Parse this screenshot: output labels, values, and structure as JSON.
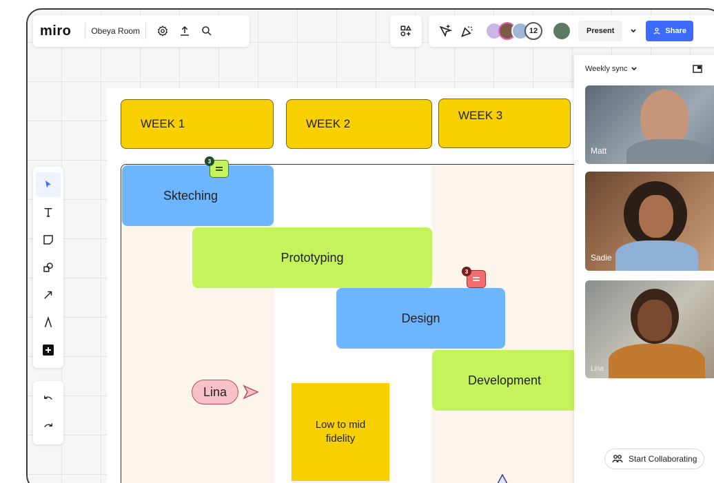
{
  "app": {
    "logo": "miro",
    "board_name": "Obeya Room"
  },
  "toolbar_top": {
    "icons": [
      "settings-icon",
      "upload-icon",
      "search-icon",
      "shapes-grid-icon",
      "filter-icon",
      "celebrate-icon"
    ],
    "avatars_overflow_count": "12",
    "present_label": "Present",
    "share_label": "Share"
  },
  "weeks": [
    "WEEK 1",
    "WEEK 2",
    "WEEK 3"
  ],
  "tasks": [
    "Skteching",
    "Prototyping",
    "Design",
    "Development"
  ],
  "comments": [
    {
      "count": "3"
    },
    {
      "count": "3"
    }
  ],
  "cursor_label": "Lina",
  "sticky_note": "Low to mid fidelity",
  "side_panel": {
    "meeting_name": "Weekly sync",
    "participants": [
      "Matt",
      "Sadie",
      "Lina"
    ],
    "collaborate_label": "Start Collaborating"
  },
  "colors": {
    "week_yellow": "#f8d000",
    "task_blue": "#6eb5ff",
    "task_green": "#c4f35c",
    "comment_red": "#f26d6d",
    "share_blue": "#3d6bff"
  }
}
